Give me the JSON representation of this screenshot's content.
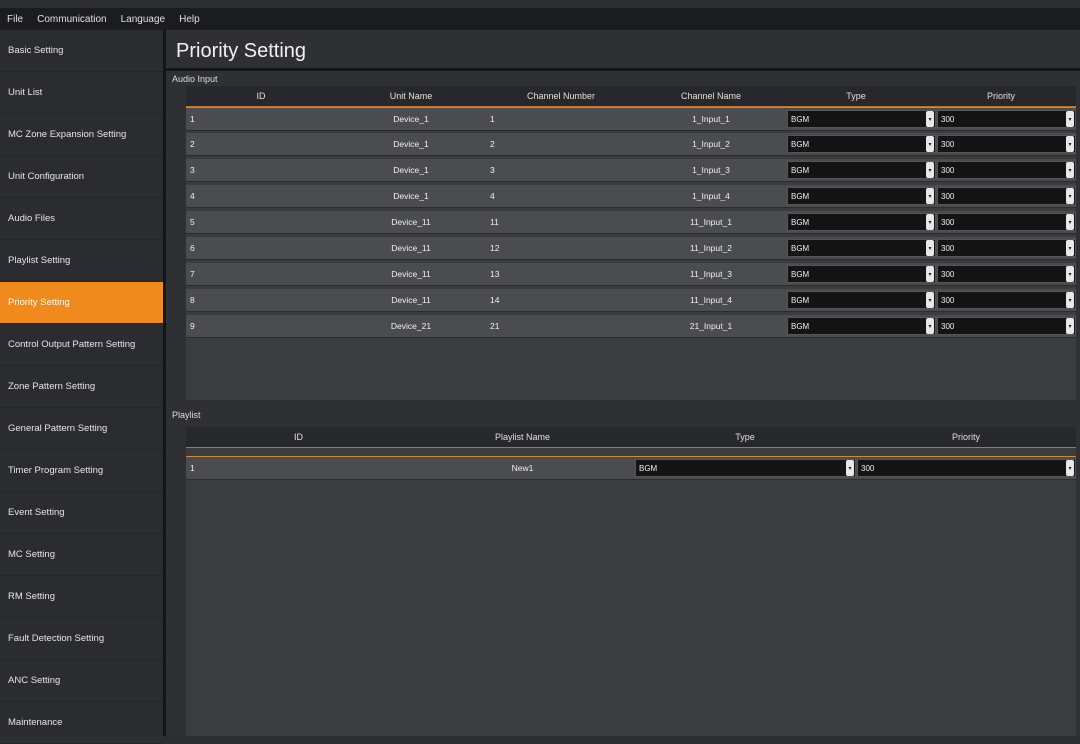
{
  "menubar": {
    "items": [
      "File",
      "Communication",
      "Language",
      "Help"
    ]
  },
  "sidebar": {
    "items": [
      {
        "label": "Basic Setting"
      },
      {
        "label": "Unit List"
      },
      {
        "label": "MC Zone Expansion Setting"
      },
      {
        "label": "Unit Configuration"
      },
      {
        "label": "Audio Files"
      },
      {
        "label": "Playlist Setting"
      },
      {
        "label": "Priority Setting",
        "active": true
      },
      {
        "label": "Control Output Pattern Setting"
      },
      {
        "label": "Zone Pattern Setting"
      },
      {
        "label": "General Pattern Setting"
      },
      {
        "label": "Timer Program Setting"
      },
      {
        "label": "Event Setting"
      },
      {
        "label": "MC Setting"
      },
      {
        "label": "RM Setting"
      },
      {
        "label": "Fault Detection Setting"
      },
      {
        "label": "ANC Setting"
      },
      {
        "label": "Maintenance"
      }
    ]
  },
  "page": {
    "title": "Priority Setting"
  },
  "audio_input": {
    "label": "Audio Input",
    "columns": [
      "ID",
      "Unit Name",
      "Channel Number",
      "Channel Name",
      "Type",
      "Priority"
    ],
    "rows": [
      {
        "id": "1",
        "unit": "Device_1",
        "channel_number": "1",
        "channel_name": "1_Input_1",
        "type": "BGM",
        "priority": "300"
      },
      {
        "id": "2",
        "unit": "Device_1",
        "channel_number": "2",
        "channel_name": "1_Input_2",
        "type": "BGM",
        "priority": "300"
      },
      {
        "id": "3",
        "unit": "Device_1",
        "channel_number": "3",
        "channel_name": "1_Input_3",
        "type": "BGM",
        "priority": "300"
      },
      {
        "id": "4",
        "unit": "Device_1",
        "channel_number": "4",
        "channel_name": "1_Input_4",
        "type": "BGM",
        "priority": "300"
      },
      {
        "id": "5",
        "unit": "Device_11",
        "channel_number": "11",
        "channel_name": "11_Input_1",
        "type": "BGM",
        "priority": "300"
      },
      {
        "id": "6",
        "unit": "Device_11",
        "channel_number": "12",
        "channel_name": "11_Input_2",
        "type": "BGM",
        "priority": "300"
      },
      {
        "id": "7",
        "unit": "Device_11",
        "channel_number": "13",
        "channel_name": "11_Input_3",
        "type": "BGM",
        "priority": "300"
      },
      {
        "id": "8",
        "unit": "Device_11",
        "channel_number": "14",
        "channel_name": "11_Input_4",
        "type": "BGM",
        "priority": "300"
      },
      {
        "id": "9",
        "unit": "Device_21",
        "channel_number": "21",
        "channel_name": "21_Input_1",
        "type": "BGM",
        "priority": "300"
      }
    ]
  },
  "playlist": {
    "label": "Playlist",
    "columns": [
      "ID",
      "Playlist Name",
      "Type",
      "Priority"
    ],
    "rows": [
      {
        "id": "1",
        "name": "New1",
        "type": "BGM",
        "priority": "300"
      }
    ]
  },
  "colors": {
    "accent": "#f08a1c",
    "background": "#2e3033",
    "sidebar": "#2a2c2f"
  },
  "icons": {
    "dropdown": "chevron-down-icon"
  }
}
